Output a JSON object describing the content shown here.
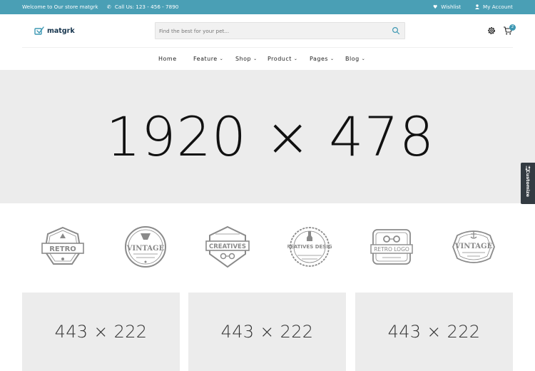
{
  "topbar": {
    "welcome": "Welcome to Our store matgrk",
    "call": "Call Us: 123 - 456 - 7890",
    "wishlist": "Wishlist",
    "account": "My Account",
    "phone_icon": "phone-icon",
    "heart_icon": "heart-icon",
    "user_icon": "user-icon"
  },
  "header": {
    "logo_text": "matgrk",
    "search_placeholder": "Find the best for your pet...",
    "cart_count": "2",
    "settings_icon": "gear-icon",
    "cart_icon": "cart-icon"
  },
  "nav": {
    "items": [
      {
        "label": "Home",
        "has_menu": false
      },
      {
        "label": "Feature",
        "has_menu": true
      },
      {
        "label": "Shop",
        "has_menu": true
      },
      {
        "label": "Product",
        "has_menu": true
      },
      {
        "label": "Pages",
        "has_menu": true
      },
      {
        "label": "Blog",
        "has_menu": true
      }
    ]
  },
  "hero": {
    "text": "1920 × 478"
  },
  "customize": {
    "label": "Customize"
  },
  "brands": [
    {
      "name": "RETRO",
      "kind": "retro-badge"
    },
    {
      "name": "VINTAGE",
      "kind": "vintage-circle"
    },
    {
      "name": "CREATIVES",
      "kind": "creatives-shield"
    },
    {
      "name": "CREATIVES DESIGN",
      "kind": "creatives-design"
    },
    {
      "name": "RETRO LOGO",
      "kind": "retro-logo"
    },
    {
      "name": "VINTAGE",
      "kind": "vintage-label"
    }
  ],
  "banners": [
    {
      "text": "443 × 222"
    },
    {
      "text": "443 × 222"
    },
    {
      "text": "443 × 222"
    }
  ],
  "colors": {
    "topbar": "#4a9fb5",
    "accent": "#3d98b3",
    "placeholder_bg": "#ececec",
    "logo_gray": "#8a8a8a"
  }
}
